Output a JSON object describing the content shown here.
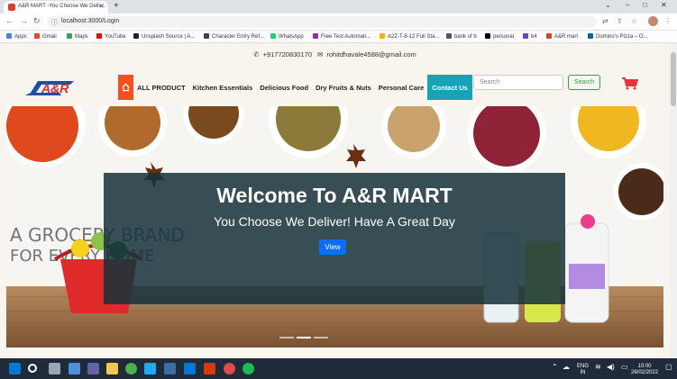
{
  "browser": {
    "tab_title": "A&R MART -You Choose We Deliv...",
    "url": "localhost:3000/Login",
    "bookmarks": [
      {
        "label": "Apps",
        "color": "#4285f4"
      },
      {
        "label": "Gmail",
        "color": "#ea4335"
      },
      {
        "label": "Maps",
        "color": "#34a853"
      },
      {
        "label": "YouTube",
        "color": "#ff0000"
      },
      {
        "label": "Unsplash Source | A...",
        "color": "#222222"
      },
      {
        "label": "Character Entry Ref...",
        "color": "#444444"
      },
      {
        "label": "WhatsApp",
        "color": "#25d366"
      },
      {
        "label": "Free Test Automati...",
        "color": "#9c27b0"
      },
      {
        "label": "A2Z-T-8-12 Full Sta...",
        "color": "#f4b400"
      },
      {
        "label": "bank of b",
        "color": "#555555"
      },
      {
        "label": "personal",
        "color": "#000000"
      },
      {
        "label": "b4",
        "color": "#6f42c1"
      },
      {
        "label": "A&R mart",
        "color": "#e03b2d"
      },
      {
        "label": "Domino's Pizza – O...",
        "color": "#0b64a0"
      }
    ]
  },
  "site": {
    "phone": "+917720830170",
    "email": "rohitdhavale4588@gmail.com",
    "logo_text": "A&R",
    "nav": [
      "ALL PRODUCT",
      "Kitchen Essentials",
      "Delicious Food",
      "Dry Fruits & Nuts",
      "Personal Care",
      "Contact Us"
    ],
    "search_placeholder": "Search",
    "search_button": "Search",
    "hero": {
      "title": "Welcome To A&R MART",
      "subtitle": "You Choose We Deliver! Have A Great Day",
      "button": "View",
      "slide_count": 3,
      "active_slide": 1
    },
    "colors": {
      "accent": "#f4511e",
      "contact": "#17a2b8",
      "cart": "#e8333a"
    }
  },
  "taskbar": {
    "lang": "ENG",
    "region": "IN",
    "time": "10:00",
    "date": "26/02/2022"
  }
}
